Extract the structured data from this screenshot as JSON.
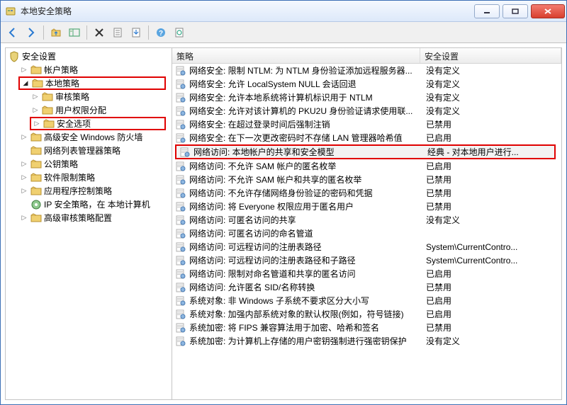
{
  "window": {
    "title": "本地安全策略"
  },
  "list": {
    "col_policy": "策略",
    "col_setting": "安全设置"
  },
  "tree": {
    "root": "安全设置",
    "accounts": "帐户策略",
    "local": "本地策略",
    "audit": "审核策略",
    "rights": "用户权限分配",
    "secopt": "安全选项",
    "firewall": "高级安全 Windows 防火墙",
    "netlist": "网络列表管理器策略",
    "pubkey": "公钥策略",
    "restrict": "软件限制策略",
    "appctrl": "应用程序控制策略",
    "ipsec": "IP 安全策略，在 本地计算机",
    "advaudit": "高级审核策略配置"
  },
  "rows": [
    {
      "p": "网络安全: 限制 NTLM: 为 NTLM 身份验证添加远程服务器...",
      "s": "没有定义"
    },
    {
      "p": "网络安全: 允许 LocalSystem NULL 会话回退",
      "s": "没有定义"
    },
    {
      "p": "网络安全: 允许本地系统将计算机标识用于 NTLM",
      "s": "没有定义"
    },
    {
      "p": "网络安全: 允许对该计算机的 PKU2U 身份验证请求使用联...",
      "s": "没有定义"
    },
    {
      "p": "网络安全: 在超过登录时间后强制注销",
      "s": "已禁用"
    },
    {
      "p": "网络安全: 在下一次更改密码时不存储 LAN 管理器哈希值",
      "s": "已启用"
    },
    {
      "p": "网络访问: 本地帐户的共享和安全模型",
      "s": "经典 - 对本地用户进行...",
      "highlight": true,
      "selected": true
    },
    {
      "p": "网络访问: 不允许 SAM 帐户的匿名枚举",
      "s": "已启用"
    },
    {
      "p": "网络访问: 不允许 SAM 帐户和共享的匿名枚举",
      "s": "已禁用"
    },
    {
      "p": "网络访问: 不允许存储网络身份验证的密码和凭据",
      "s": "已禁用"
    },
    {
      "p": "网络访问: 将 Everyone 权限应用于匿名用户",
      "s": "已禁用"
    },
    {
      "p": "网络访问: 可匿名访问的共享",
      "s": "没有定义"
    },
    {
      "p": "网络访问: 可匿名访问的命名管道",
      "s": ""
    },
    {
      "p": "网络访问: 可远程访问的注册表路径",
      "s": "System\\CurrentContro..."
    },
    {
      "p": "网络访问: 可远程访问的注册表路径和子路径",
      "s": "System\\CurrentContro..."
    },
    {
      "p": "网络访问: 限制对命名管道和共享的匿名访问",
      "s": "已启用"
    },
    {
      "p": "网络访问: 允许匿名 SID/名称转换",
      "s": "已禁用"
    },
    {
      "p": "系统对象: 非 Windows 子系统不要求区分大小写",
      "s": "已启用"
    },
    {
      "p": "系统对象: 加强内部系统对象的默认权限(例如，符号链接)",
      "s": "已启用"
    },
    {
      "p": "系统加密: 将 FIPS 兼容算法用于加密、哈希和签名",
      "s": "已禁用"
    },
    {
      "p": "系统加密: 为计算机上存储的用户密钥强制进行强密钥保护",
      "s": "没有定义"
    }
  ]
}
